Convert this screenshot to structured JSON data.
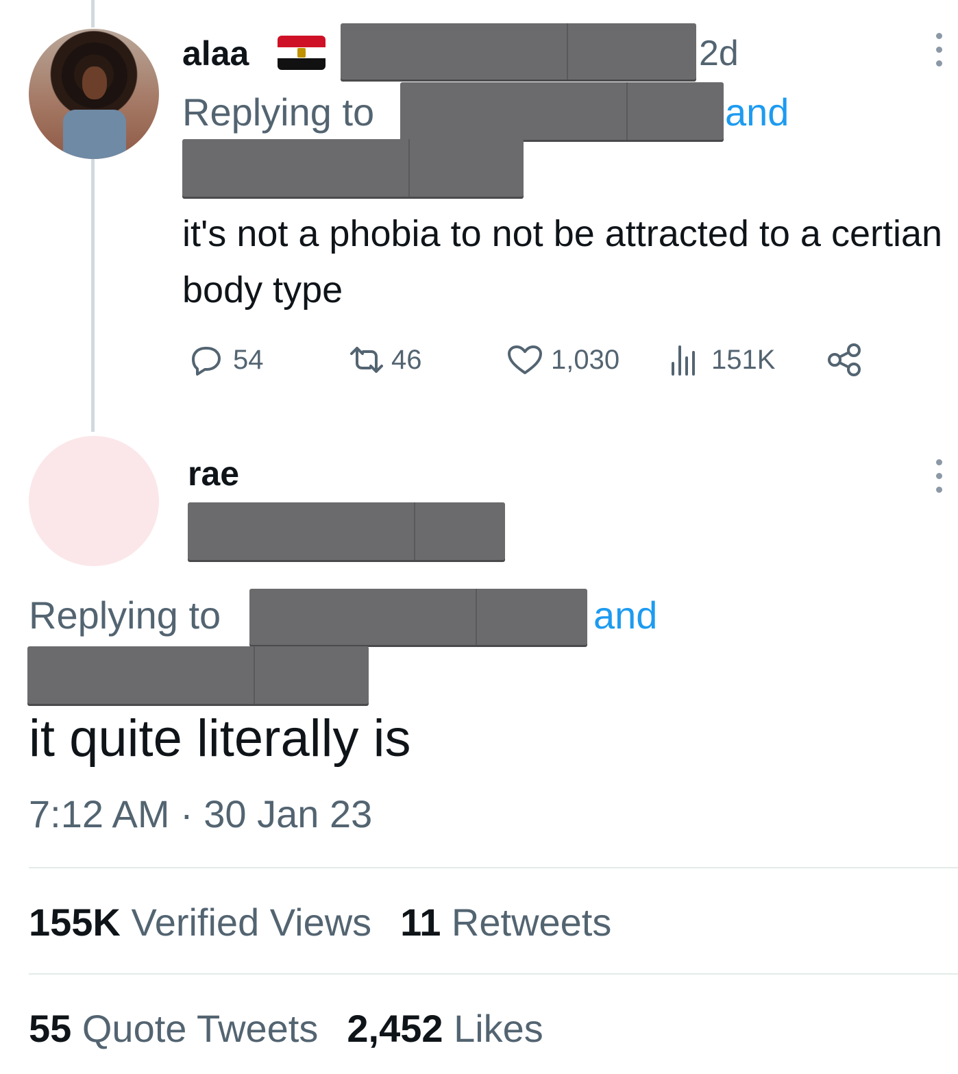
{
  "reply_parent": {
    "author_name": "alaa",
    "relative_time": "2d",
    "replying_to_label": "Replying to",
    "and_label": "and",
    "text": "it's not a phobia to not be attracted to a certian body type",
    "actions": {
      "replies": "54",
      "retweets": "46",
      "likes": "1,030",
      "views": "151K"
    }
  },
  "main_tweet": {
    "author_name": "rae",
    "replying_to_label": "Replying to",
    "and_label": "and",
    "text": "it quite literally is",
    "time": "7:12 AM",
    "separator": "·",
    "date": "30 Jan 23",
    "stats": {
      "views_count": "155K",
      "views_label": "Verified Views",
      "retweets_count": "11",
      "retweets_label": "Retweets",
      "quotes_count": "55",
      "quotes_label": "Quote Tweets",
      "likes_count": "2,452",
      "likes_label": "Likes"
    }
  },
  "colors": {
    "text_primary": "#0f1419",
    "text_secondary": "#536471",
    "link": "#1d9bf0",
    "redaction": "#6b6b6e",
    "thread_line": "#cfd9de"
  },
  "icons": [
    "reply-icon",
    "retweet-icon",
    "like-icon",
    "views-icon",
    "share-icon",
    "more-icon"
  ]
}
